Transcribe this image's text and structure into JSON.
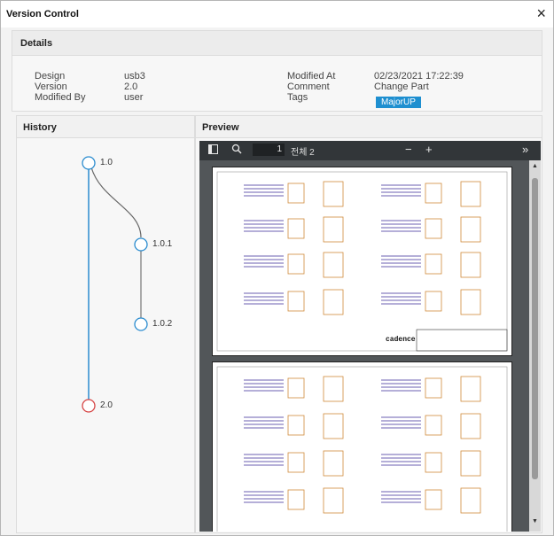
{
  "window": {
    "title": "Version Control",
    "close_glyph": "×"
  },
  "details": {
    "heading": "Details",
    "left": [
      {
        "key": "Design",
        "value": "usb3"
      },
      {
        "key": "Version",
        "value": "2.0"
      },
      {
        "key": "Modified By",
        "value": "user"
      }
    ],
    "right": [
      {
        "key": "Modified At",
        "value": "02/23/2021 17:22:39"
      },
      {
        "key": "Comment",
        "value": "Change Part"
      },
      {
        "key": "Tags",
        "value": "MajorUP"
      }
    ],
    "tag_color": "#1e8fd0"
  },
  "history": {
    "heading": "History",
    "nodes": [
      {
        "label": "1.0",
        "color": "#2b8ccf"
      },
      {
        "label": "1.0.1",
        "color": "#2b8ccf"
      },
      {
        "label": "1.0.2",
        "color": "#2b8ccf"
      },
      {
        "label": "2.0",
        "color": "#d64545"
      }
    ]
  },
  "preview": {
    "heading": "Preview",
    "toolbar": {
      "sidebar_icon": "sidebar-toggle-icon",
      "search_icon": "search-icon",
      "page_number": "1",
      "page_total": "전체 2",
      "zoom_out": "−",
      "zoom_in": "+",
      "more": "»"
    },
    "logo_text": "cadence"
  }
}
